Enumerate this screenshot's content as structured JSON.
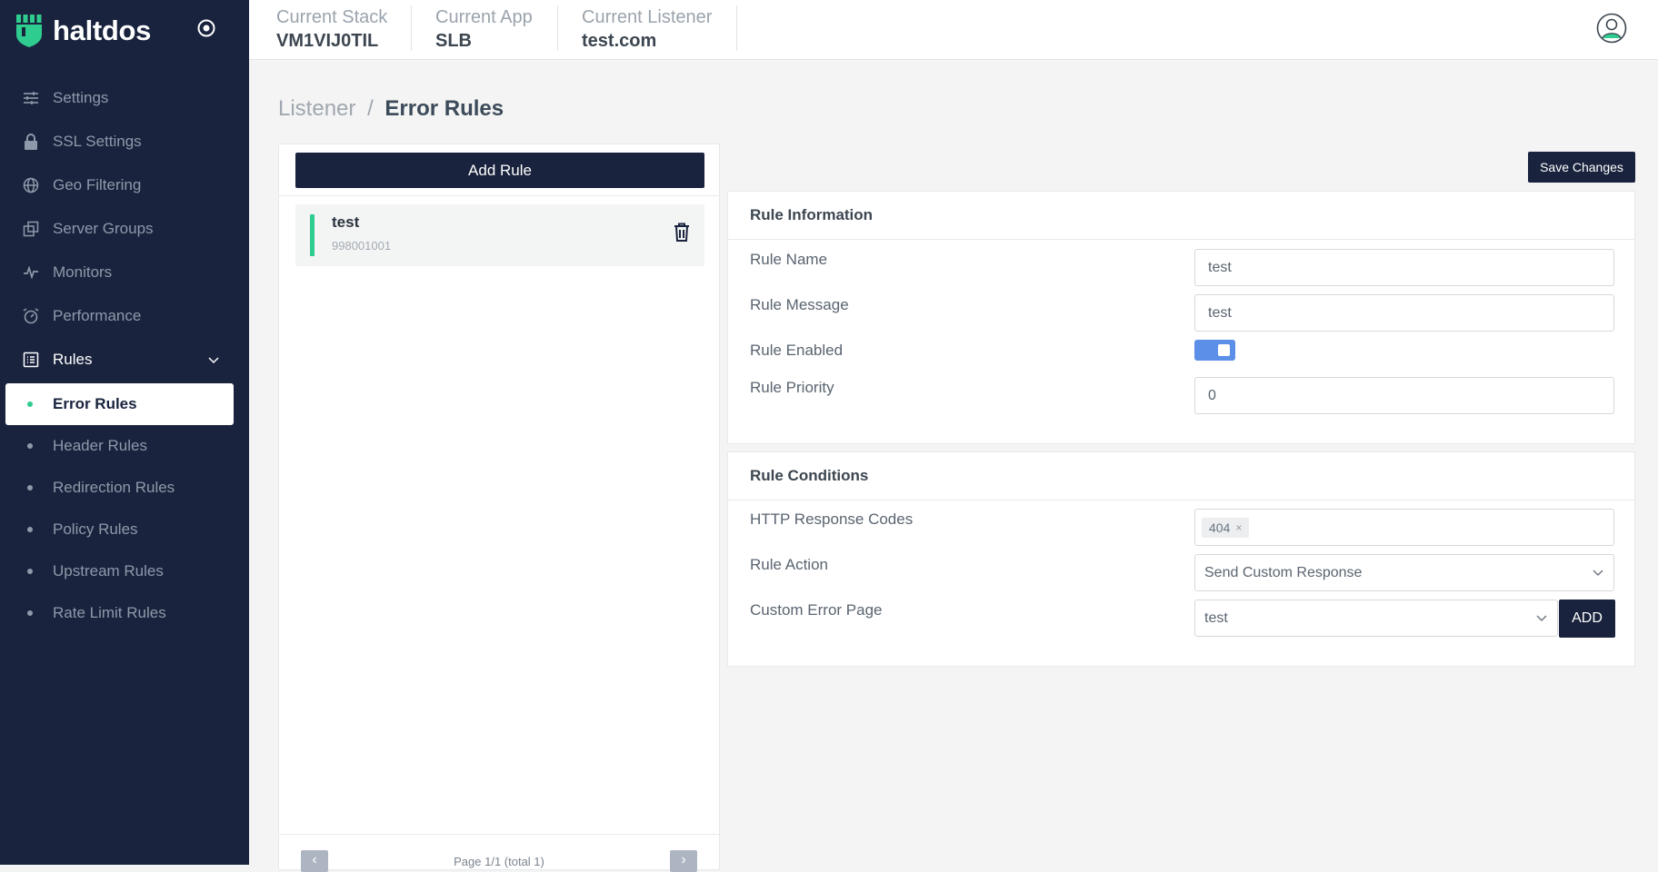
{
  "brand": {
    "name": "haltdos"
  },
  "sidebar": {
    "items": [
      {
        "label": "Settings",
        "icon": "sliders-icon"
      },
      {
        "label": "SSL Settings",
        "icon": "lock-icon"
      },
      {
        "label": "Geo Filtering",
        "icon": "globe-icon"
      },
      {
        "label": "Server Groups",
        "icon": "stack-icon"
      },
      {
        "label": "Monitors",
        "icon": "pulse-icon"
      },
      {
        "label": "Performance",
        "icon": "speedometer-icon"
      },
      {
        "label": "Rules",
        "icon": "list-icon"
      }
    ],
    "rules_submenu": [
      {
        "label": "Error Rules",
        "active": true
      },
      {
        "label": "Header Rules"
      },
      {
        "label": "Redirection Rules"
      },
      {
        "label": "Policy Rules"
      },
      {
        "label": "Upstream Rules"
      },
      {
        "label": "Rate Limit Rules"
      }
    ]
  },
  "topbar": {
    "stack": {
      "label": "Current Stack",
      "value": "VM1VIJ0TIL"
    },
    "app": {
      "label": "Current App",
      "value": "SLB"
    },
    "listener": {
      "label": "Current Listener",
      "value": "test.com"
    }
  },
  "breadcrumb": {
    "parent": "Listener",
    "separator": "/",
    "current": "Error Rules"
  },
  "rules_panel": {
    "add_label": "Add Rule",
    "rules": [
      {
        "name": "test",
        "id": "998001001"
      }
    ],
    "pagination": {
      "text": "Page 1/1 (total 1)",
      "prev": "‹",
      "next": "›"
    }
  },
  "save_label": "Save Changes",
  "rule_info": {
    "title": "Rule Information",
    "name_label": "Rule Name",
    "name_value": "test",
    "message_label": "Rule Message",
    "message_value": "test",
    "enabled_label": "Rule Enabled",
    "enabled": true,
    "priority_label": "Rule Priority",
    "priority_value": "0"
  },
  "rule_conditions": {
    "title": "Rule Conditions",
    "codes_label": "HTTP Response Codes",
    "codes": [
      "404"
    ],
    "action_label": "Rule Action",
    "action_value": "Send Custom Response",
    "page_label": "Custom Error Page",
    "page_value": "test",
    "add_label": "ADD"
  },
  "colors": {
    "sidebar_bg": "#19233d",
    "accent_green": "#2ecc8f",
    "toggle_blue": "#5b8fe8",
    "page_bg": "#f3f4f3"
  }
}
